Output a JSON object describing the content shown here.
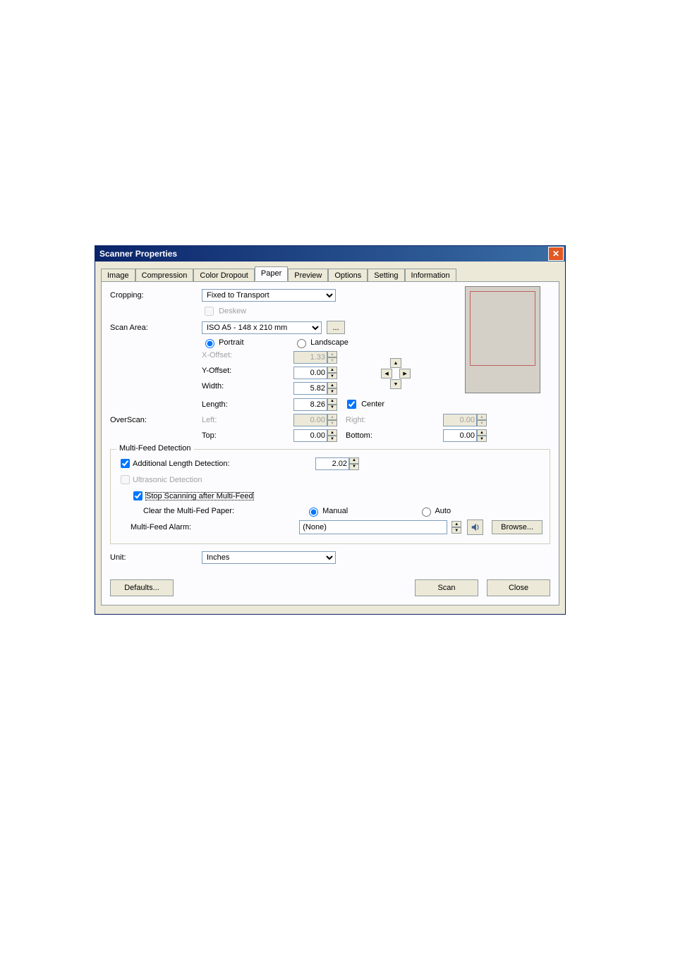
{
  "window": {
    "title": "Scanner Properties"
  },
  "tabs": {
    "image": "Image",
    "compression": "Compression",
    "color_dropout": "Color Dropout",
    "paper": "Paper",
    "preview": "Preview",
    "options": "Options",
    "setting": "Setting",
    "information": "Information"
  },
  "paper": {
    "cropping_label": "Cropping:",
    "cropping_value": "Fixed to Transport",
    "deskew_label": "Deskew",
    "scan_area_label": "Scan Area:",
    "scan_area_value": "ISO A5 - 148 x 210 mm",
    "ellipsis": "...",
    "portrait_label": "Portrait",
    "landscape_label": "Landscape",
    "xoffset_label": "X-Offset:",
    "xoffset_value": "1.33",
    "yoffset_label": "Y-Offset:",
    "yoffset_value": "0.00",
    "width_label": "Width:",
    "width_value": "5.82",
    "length_label": "Length:",
    "length_value": "8.26",
    "center_label": "Center",
    "overscan_label": "OverScan:",
    "left_label": "Left:",
    "left_value": "0.00",
    "top_label": "Top:",
    "top_value": "0.00",
    "right_label": "Right:",
    "right_value": "0.00",
    "bottom_label": "Bottom:",
    "bottom_value": "0.00"
  },
  "mfd": {
    "group_title": "Multi-Feed Detection",
    "add_len_label": "Additional Length Detection:",
    "add_len_value": "2.02",
    "ultrasonic_label": "Ultrasonic Detection",
    "stop_label": "Stop Scanning after Multi-Feed",
    "clear_label": "Clear the Multi-Fed Paper:",
    "manual_label": "Manual",
    "auto_label": "Auto",
    "alarm_label": "Multi-Feed Alarm:",
    "alarm_value": "(None)",
    "browse_label": "Browse..."
  },
  "unit": {
    "label": "Unit:",
    "value": "Inches"
  },
  "buttons": {
    "defaults": "Defaults...",
    "scan": "Scan",
    "close": "Close"
  }
}
